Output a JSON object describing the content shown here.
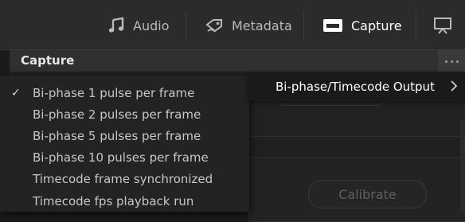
{
  "tabs": [
    {
      "label": "Audio",
      "icon": "music-note-icon"
    },
    {
      "label": "Metadata",
      "icon": "metadata-tag-icon"
    },
    {
      "label": "Capture",
      "icon": "tape-deck-icon",
      "active": true
    },
    {
      "label": "",
      "icon": "monitor-icon"
    }
  ],
  "panel": {
    "title": "Capture"
  },
  "menu": {
    "items": [
      {
        "label": "Bi-phase 1 pulse per frame",
        "checked": true
      },
      {
        "label": "Bi-phase 2 pulses per frame",
        "checked": false
      },
      {
        "label": "Bi-phase 5 pulses per frame",
        "checked": false
      },
      {
        "label": "Bi-phase 10 pulses per frame",
        "checked": false
      },
      {
        "label": "Timecode frame synchronized",
        "checked": false
      },
      {
        "label": "Timecode fps playback run",
        "checked": false
      }
    ],
    "check_glyph": "✓"
  },
  "submenu": {
    "label": "Bi-phase/Timecode Output",
    "icon": "chevron-right-icon"
  },
  "buttons": {
    "calibrate": "Calibrate"
  },
  "colors": {
    "background": "#1b1b1d",
    "tabbar": "#2b2b2e",
    "menu": "#232325",
    "submenu": "#1a1a1c"
  }
}
